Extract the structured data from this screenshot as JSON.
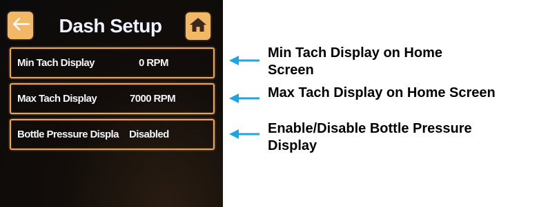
{
  "screen": {
    "title": "Dash Setup",
    "back_icon": "back-arrow-icon",
    "home_icon": "home-icon",
    "accent_color": "#f2b865",
    "border_color": "#e8a560"
  },
  "settings": [
    {
      "label": "Min Tach Display",
      "value": "0 RPM"
    },
    {
      "label": "Max Tach Display",
      "value": "7000 RPM"
    },
    {
      "label": "Bottle Pressure Displa",
      "value": "Disabled"
    }
  ],
  "callouts": [
    {
      "line1": "Min Tach Display on Home",
      "line2": "Screen"
    },
    {
      "line1": "Max Tach Display on Home Screen",
      "line2": ""
    },
    {
      "line1": "Enable/Disable Bottle Pressure",
      "line2": "Display"
    }
  ],
  "callout_arrow_color": "#1ea3e3"
}
